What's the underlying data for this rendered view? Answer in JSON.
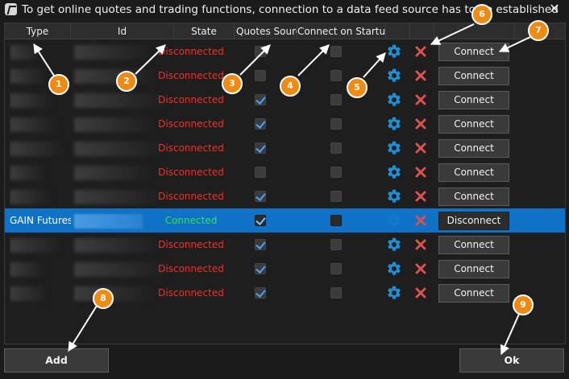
{
  "window": {
    "title": "To get online quotes and trading functions, connection to a data feed source has to be established",
    "close_glyph": "✕"
  },
  "columns": {
    "type": "Type",
    "id": "Id",
    "state": "State",
    "quotes_source": "Quotes Source",
    "connect_on_startup": "Connect on Startup"
  },
  "rows": [
    {
      "type": "",
      "state": "Disconnected",
      "quotes_source": false,
      "connect_on_startup": false,
      "button": "Connect",
      "selected": false
    },
    {
      "type": "",
      "state": "Disconnected",
      "quotes_source": false,
      "connect_on_startup": false,
      "button": "Connect",
      "selected": false
    },
    {
      "type": "",
      "state": "Disconnected",
      "quotes_source": true,
      "connect_on_startup": false,
      "button": "Connect",
      "selected": false
    },
    {
      "type": "",
      "state": "Disconnected",
      "quotes_source": true,
      "connect_on_startup": false,
      "button": "Connect",
      "selected": false
    },
    {
      "type": "",
      "state": "Disconnected",
      "quotes_source": true,
      "connect_on_startup": false,
      "button": "Connect",
      "selected": false
    },
    {
      "type": "",
      "state": "Disconnected",
      "quotes_source": false,
      "connect_on_startup": false,
      "button": "Connect",
      "selected": false
    },
    {
      "type": "",
      "state": "Disconnected",
      "quotes_source": true,
      "connect_on_startup": false,
      "button": "Connect",
      "selected": false
    },
    {
      "type": "GAIN Futures",
      "state": "Connected",
      "quotes_source": true,
      "connect_on_startup": false,
      "button": "Disconnect",
      "selected": true
    },
    {
      "type": "",
      "state": "Disconnected",
      "quotes_source": true,
      "connect_on_startup": false,
      "button": "Connect",
      "selected": false
    },
    {
      "type": "",
      "state": "Disconnected",
      "quotes_source": true,
      "connect_on_startup": false,
      "button": "Connect",
      "selected": false
    },
    {
      "type": "",
      "state": "Disconnected",
      "quotes_source": true,
      "connect_on_startup": false,
      "button": "Connect",
      "selected": false
    }
  ],
  "footer": {
    "add_label": "Add",
    "ok_label": "Ok"
  },
  "annotations": [
    "1",
    "2",
    "3",
    "4",
    "5",
    "6",
    "7",
    "8",
    "9"
  ],
  "colors": {
    "accent": "#f08a12",
    "selected_row": "#1072c6",
    "disconnected": "#f0302a",
    "connected": "#35e04e",
    "gear": "#1e8fd6",
    "delete": "#d9534f"
  }
}
